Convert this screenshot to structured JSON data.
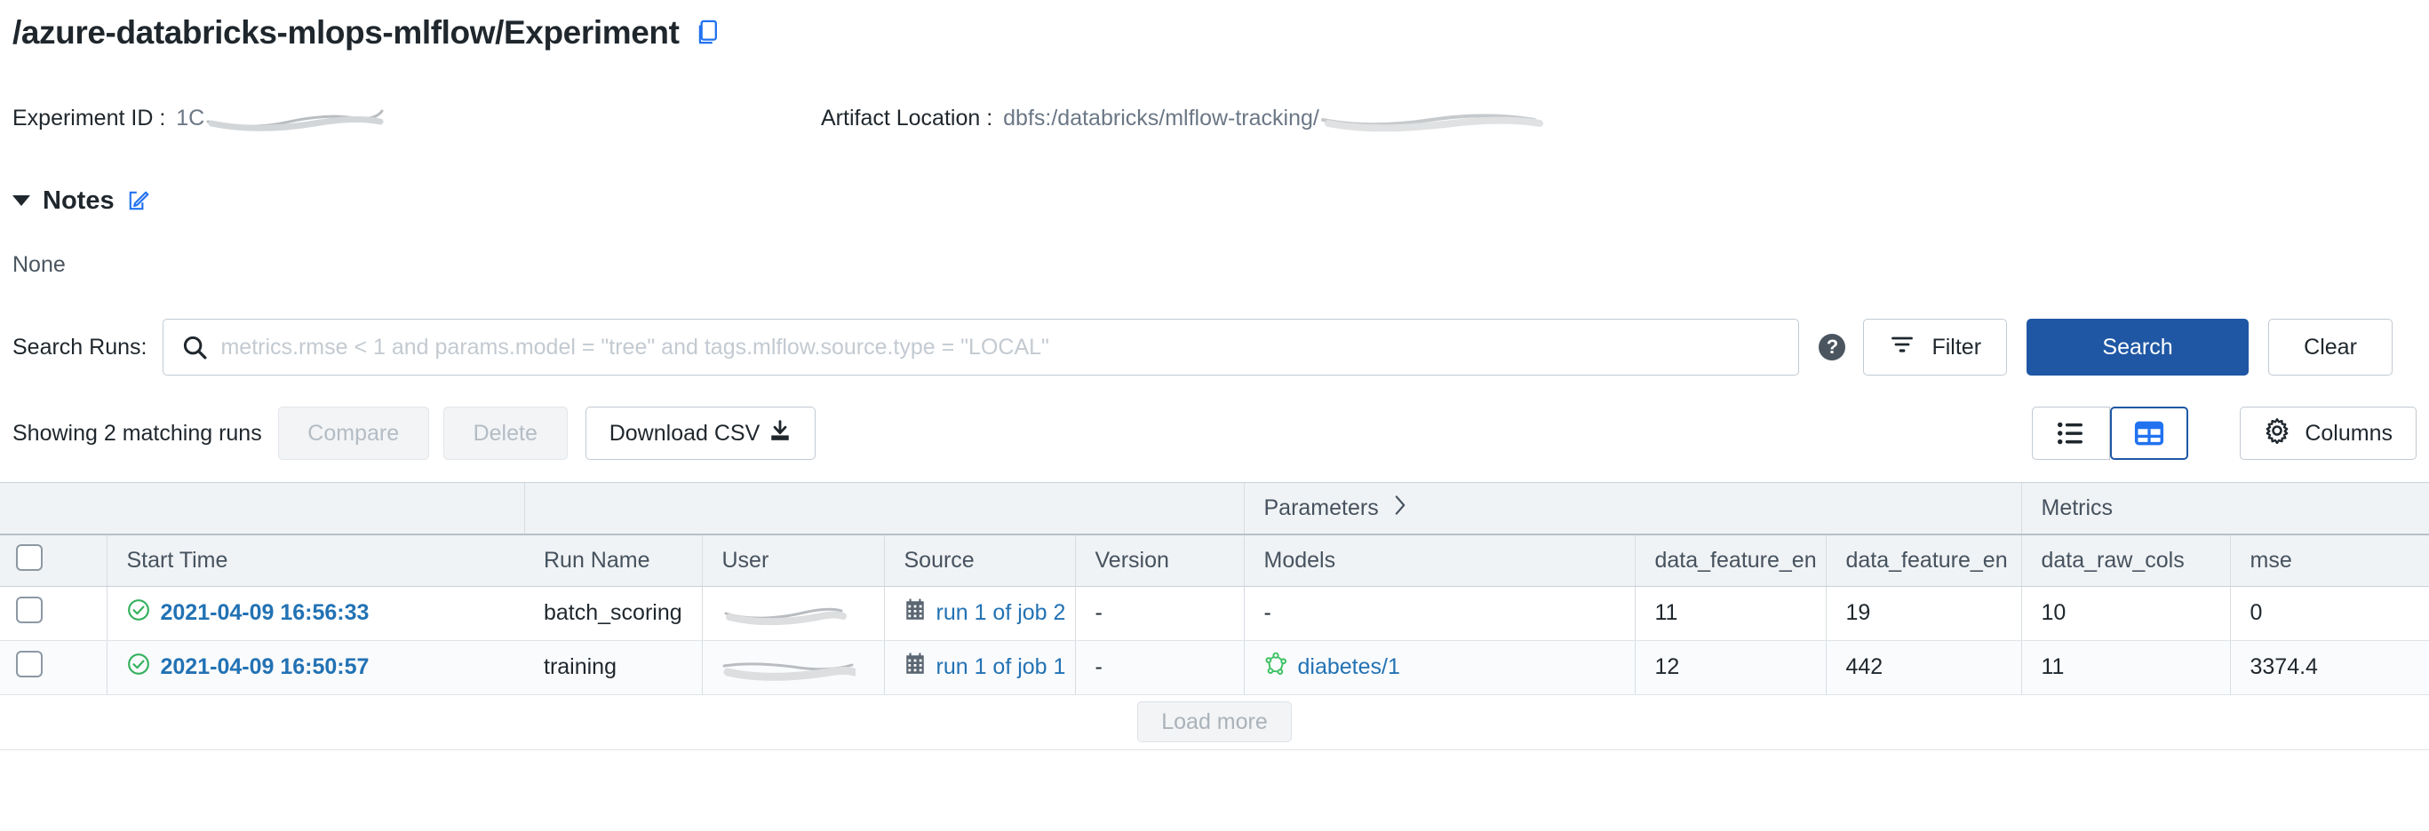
{
  "header": {
    "experiment_path": "/azure-databricks-mlops-mlflow/Experiment",
    "copy_icon": "copy-icon"
  },
  "meta": {
    "experiment_id_label": "Experiment ID :",
    "experiment_id_value": "1C",
    "artifact_location_label": "Artifact Location :",
    "artifact_location_value": "dbfs:/databricks/mlflow-tracking/"
  },
  "notes": {
    "title": "Notes",
    "edit_icon": "edit-pencil-icon",
    "body": "None"
  },
  "search": {
    "label": "Search Runs:",
    "value": "",
    "placeholder": "metrics.rmse < 1 and params.model = \"tree\" and tags.mlflow.source.type = \"LOCAL\"",
    "search_icon": "search-icon",
    "help_icon": "question-mark-icon",
    "filter_label": "Filter",
    "filter_icon": "filter-funnel-icon",
    "search_button": "Search",
    "clear_button": "Clear"
  },
  "actions": {
    "showing_text": "Showing 2 matching runs",
    "compare_label": "Compare",
    "delete_label": "Delete",
    "download_csv_label": "Download CSV",
    "download_icon": "download-icon",
    "list_view_icon": "list-view-icon",
    "table_view_icon": "table-view-icon",
    "columns_label": "Columns",
    "columns_icon": "gear-icon",
    "load_more_label": "Load more"
  },
  "colors": {
    "primary_blue": "#1f57a4",
    "link_blue": "#2272b4",
    "accent_blue": "#2272f0",
    "success_green": "#35b15e",
    "model_green": "#3ac162",
    "header_bg": "#f0f3f5"
  },
  "table": {
    "group_headers": {
      "parameters": "Parameters",
      "parameters_chevron": "chevron-right-icon",
      "metrics": "Metrics"
    },
    "columns": [
      "Start Time",
      "Run Name",
      "User",
      "Source",
      "Version",
      "Models",
      "data_feature_en",
      "data_feature_en",
      "data_raw_cols",
      "mse"
    ],
    "rows": [
      {
        "status_icon": "check-circle-icon",
        "start_time": "2021-04-09 16:56:33",
        "run_name": "batch_scoring",
        "user": "",
        "source_icon": "job-calendar-icon",
        "source": "run 1 of job 2",
        "version": "-",
        "model_icon": "",
        "models": "-",
        "data_feature_en_1": "11",
        "data_feature_en_2": "19",
        "data_raw_cols": "10",
        "mse": "0"
      },
      {
        "status_icon": "check-circle-icon",
        "start_time": "2021-04-09 16:50:57",
        "run_name": "training",
        "user": "",
        "source_icon": "job-calendar-icon",
        "source": "run 1 of job 1",
        "version": "-",
        "model_icon": "mlflow-model-icon",
        "models": "diabetes/1",
        "data_feature_en_1": "12",
        "data_feature_en_2": "442",
        "data_raw_cols": "11",
        "mse": "3374.4"
      }
    ]
  }
}
